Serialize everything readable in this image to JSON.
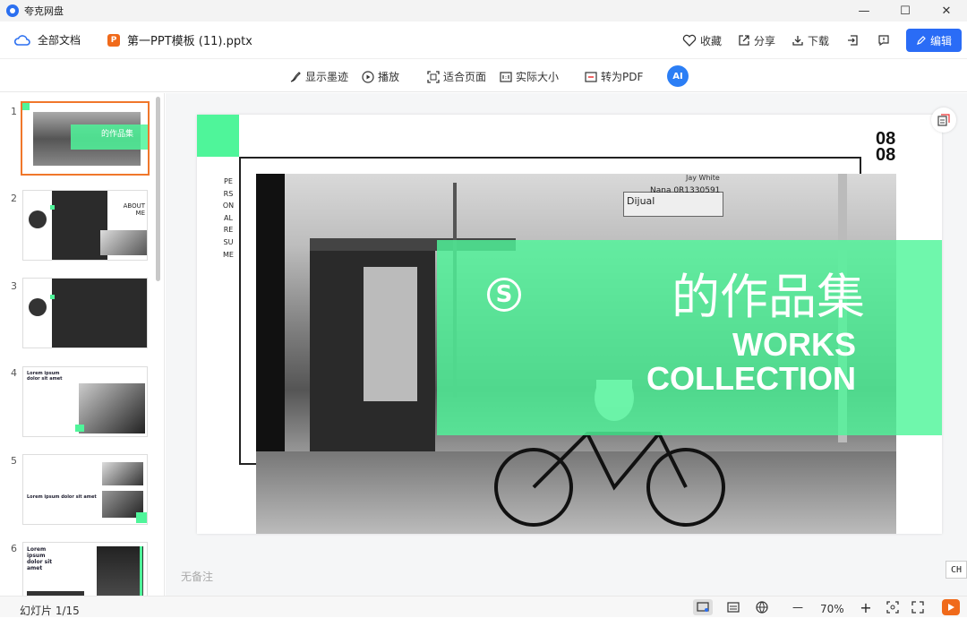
{
  "app": {
    "name": "夸克网盘"
  },
  "window": {
    "minimize": "—",
    "maximize": "☐",
    "close": "✕"
  },
  "header": {
    "all_docs": "全部文档",
    "file_badge": "P",
    "file_name": "第一PPT模板 (11).pptx",
    "favorite": "收藏",
    "share": "分享",
    "download": "下载",
    "edit": "编辑"
  },
  "toolbar": {
    "show_ink": "显示墨迹",
    "play": "播放",
    "fit_page": "适合页面",
    "actual_size": "实际大小",
    "to_pdf": "转为PDF",
    "ai": "AI"
  },
  "thumbnails": [
    {
      "num": "1",
      "title": "的作品集"
    },
    {
      "num": "2",
      "title": "ABOUT ME"
    },
    {
      "num": "3",
      "title": ""
    },
    {
      "num": "4",
      "title": "Lorem ipsum dolor sit amet"
    },
    {
      "num": "5",
      "title": "Lorem ipsum dolor sit amet"
    },
    {
      "num": "6",
      "title": "Lorem ipsum dolor sit amet"
    }
  ],
  "slide": {
    "number_top": "08",
    "number_bottom": "08",
    "vertical_text": "PERSONAL RESUME",
    "title_cn": "的作品集",
    "title_en_1": "WORKS",
    "title_en_2": "COLLECTION",
    "sign_line1": "Jay White",
    "sign_line2": "Nana 0R1330591",
    "sign_line3": "Dijual",
    "accent_color": "#4ff59a"
  },
  "notes": "无备注",
  "status": {
    "slide_count": "幻灯片 1/15",
    "zoom": "70%",
    "zoom_out": "—",
    "zoom_in": "+"
  },
  "ime": "CH"
}
